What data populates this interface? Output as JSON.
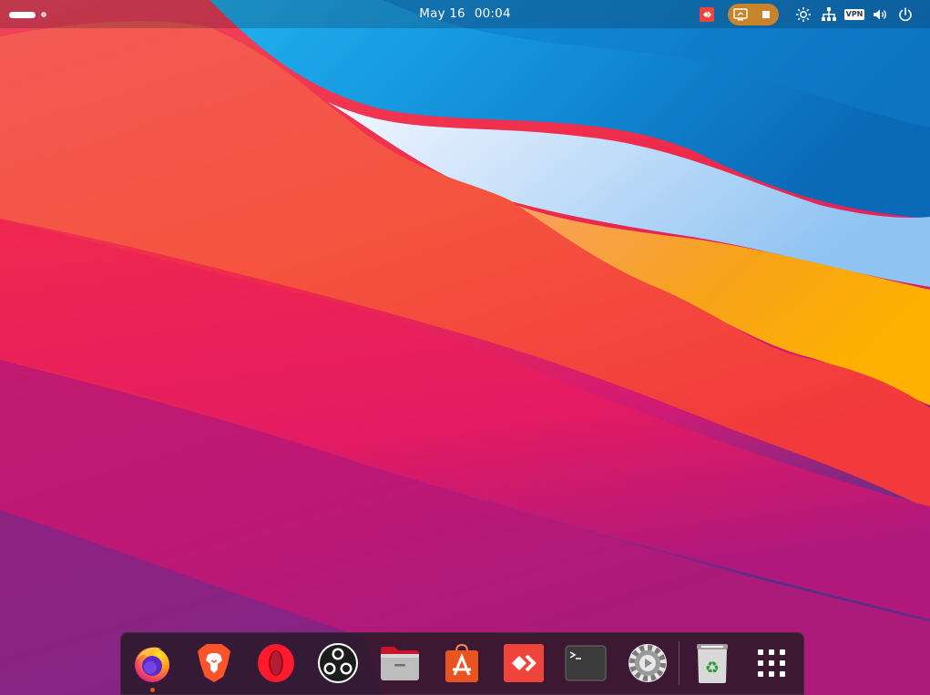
{
  "topbar": {
    "date": "May 16",
    "time": "00:04",
    "vpn_label": "VPN"
  },
  "colors": {
    "ubuntu_accent": "#e95420",
    "screencast_indicator": "#c9832a"
  },
  "dock": {
    "apps": [
      {
        "name": "Firefox",
        "icon": "firefox-icon",
        "running": true
      },
      {
        "name": "Brave",
        "icon": "brave-icon",
        "running": false
      },
      {
        "name": "Opera",
        "icon": "opera-icon",
        "running": false
      },
      {
        "name": "OBS Studio",
        "icon": "obs-icon",
        "running": false
      },
      {
        "name": "Files",
        "icon": "files-icon",
        "running": false
      },
      {
        "name": "Ubuntu Software",
        "icon": "app-store-icon",
        "running": false
      },
      {
        "name": "AnyDesk",
        "icon": "anydesk-icon",
        "running": false
      },
      {
        "name": "Terminal",
        "icon": "terminal-icon",
        "running": false
      },
      {
        "name": "Settings",
        "icon": "settings-gear-icon",
        "running": false
      },
      {
        "name": "Trash",
        "icon": "trash-icon",
        "running": false
      },
      {
        "name": "Show Applications",
        "icon": "app-grid-icon",
        "running": false
      }
    ]
  }
}
